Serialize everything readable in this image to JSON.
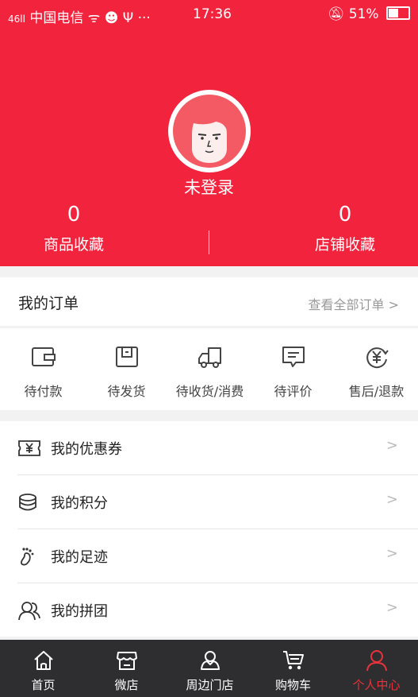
{
  "status_bar": {
    "signal": "46ll",
    "carrier": "中国电信",
    "indicators": "ᯤ ☻ Ψ ···",
    "time": "17:36",
    "battery": "51%"
  },
  "profile": {
    "login_status": "未登录",
    "product_fav_count": "0",
    "product_fav_label": "商品收藏",
    "shop_fav_count": "0",
    "shop_fav_label": "店铺收藏"
  },
  "orders": {
    "title": "我的订单",
    "view_all": "查看全部订单 >",
    "items": [
      {
        "label": "待付款",
        "icon": "wallet-icon"
      },
      {
        "label": "待发货",
        "icon": "box-icon"
      },
      {
        "label": "待收货/消费",
        "icon": "truck-icon"
      },
      {
        "label": "待评价",
        "icon": "comment-icon"
      },
      {
        "label": "售后/退款",
        "icon": "refund-icon"
      }
    ]
  },
  "menu": [
    {
      "label": "我的优惠券",
      "icon": "coupon-icon"
    },
    {
      "label": "我的积分",
      "icon": "coins-icon"
    },
    {
      "label": "我的足迹",
      "icon": "footprint-icon"
    },
    {
      "label": "我的拼团",
      "icon": "group-icon"
    }
  ],
  "tabbar": [
    {
      "label": "首页",
      "icon": "home-icon"
    },
    {
      "label": "微店",
      "icon": "store-icon"
    },
    {
      "label": "周边门店",
      "icon": "nearby-icon"
    },
    {
      "label": "购物车",
      "icon": "cart-icon"
    },
    {
      "label": "个人中心",
      "icon": "person-icon",
      "active": true
    }
  ],
  "colors": {
    "brand_red": "#f2233d",
    "tab_active": "#e8323c",
    "tabbar_bg": "#2e2e30"
  }
}
